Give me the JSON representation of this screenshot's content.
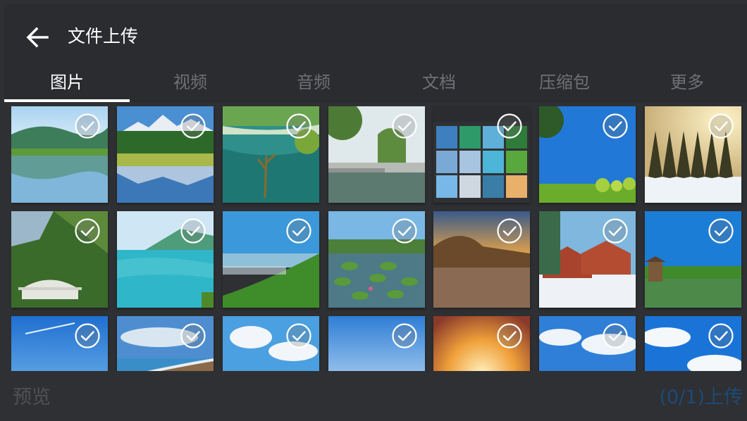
{
  "header": {
    "title": "文件上传",
    "back_icon": "back-arrow-icon"
  },
  "tabs": [
    {
      "label": "图片",
      "active": true
    },
    {
      "label": "视频",
      "active": false
    },
    {
      "label": "音频",
      "active": false
    },
    {
      "label": "文档",
      "active": false
    },
    {
      "label": "压缩包",
      "active": false
    },
    {
      "label": "更多",
      "active": false
    }
  ],
  "grid": {
    "check_icon": "circle-check-icon",
    "rows": [
      [
        "lake-mountain-reflection",
        "snow-mountain-lake",
        "teal-river",
        "willow-pond",
        "gallery-screenshot",
        "blue-sky-tree",
        "winter-forest"
      ],
      [
        "green-valley-bridge",
        "turquoise-lake",
        "green-coast",
        "lotus-pond",
        "sunset-bay",
        "snowy-cabins",
        "lakeside-pavilion"
      ],
      [
        "blue-sky-plane",
        "cloudy-beach",
        "grassland-clouds",
        "light-blue-sky",
        "sunrise-clouds",
        "white-clouds-sea",
        "clouds-blue-sky"
      ]
    ]
  },
  "footer": {
    "preview_label": "预览",
    "upload_label": "(0/1)上传"
  },
  "colors": {
    "background": "#2f3033",
    "tab_active": "#ffffff",
    "tab_inactive": "#6f7075",
    "upload_disabled": "#1c4a78",
    "preview_disabled": "#505155"
  }
}
